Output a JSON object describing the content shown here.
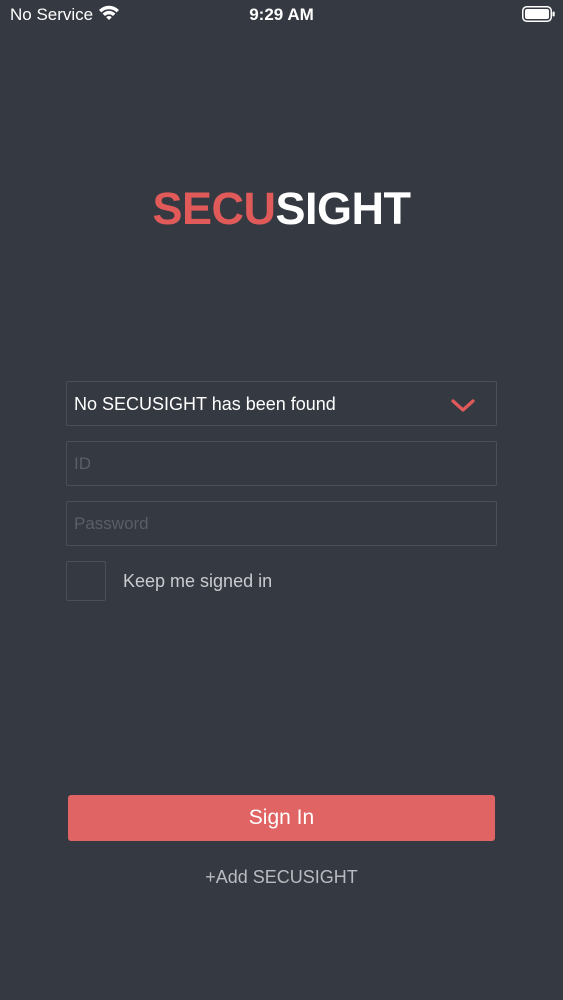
{
  "status_bar": {
    "carrier": "No Service",
    "time": "9:29 AM",
    "wifi_icon": "wifi-icon",
    "battery_icon": "battery-icon"
  },
  "logo": {
    "part1": "SECU",
    "part2": "SIGHT"
  },
  "device_select": {
    "value": "No SECUSIGHT has been found",
    "icon": "chevron-down-icon"
  },
  "id_field": {
    "placeholder": "ID",
    "value": ""
  },
  "password_field": {
    "placeholder": "Password",
    "value": ""
  },
  "keep_signed_in": {
    "label": "Keep me signed in",
    "checked": false
  },
  "sign_in_button": {
    "label": "Sign In"
  },
  "add_link": {
    "label": "+Add SECUSIGHT"
  },
  "colors": {
    "background": "#353941",
    "accent": "#e06464",
    "field_border": "#4b4f57"
  }
}
